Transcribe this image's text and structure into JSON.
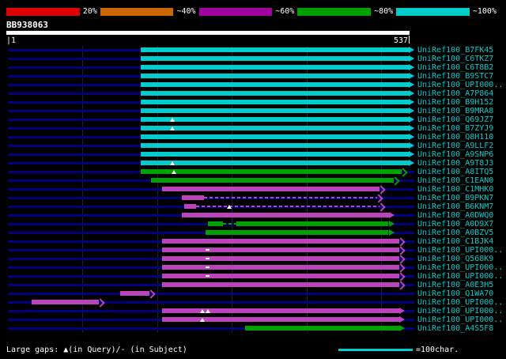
{
  "scale_bar": {
    "segments": [
      {
        "color": "#dd0000",
        "label": "20%"
      },
      {
        "color": "#cc6600",
        "label": "~40%"
      },
      {
        "color": "#a000a0",
        "label": "~60%"
      },
      {
        "color": "#00a000",
        "label": "~80%"
      },
      {
        "color": "#00cccc",
        "label": "~100%"
      }
    ]
  },
  "query": {
    "name": "BB938063",
    "start_label": "|1",
    "end_label": "537",
    "length": 537
  },
  "footer": {
    "gaps_note": "Large gaps: ▲(in Query)/- (in Subject)",
    "scale_label": "=100char."
  },
  "colors": {
    "cyan": "#00cccc",
    "green": "#00a000",
    "magenta": "#bb44bb",
    "query_line": "#000080",
    "grid": "#1a1a42",
    "label_text": "#00cccc"
  },
  "chart_data": {
    "type": "bar",
    "orientation": "horizontal-span",
    "title": "BB938063",
    "xlabel": "query position",
    "x_range": [
      1,
      537
    ],
    "grid_interval": 100,
    "rows": [
      {
        "label": "UniRef100_B7FK45",
        "color": "cyan",
        "segments": [
          [
            178,
            537
          ]
        ],
        "arrow": "filled",
        "markers": []
      },
      {
        "label": "UniRef100_C6TKZ7",
        "color": "cyan",
        "segments": [
          [
            178,
            537
          ]
        ],
        "arrow": "filled",
        "markers": []
      },
      {
        "label": "UniRef100_C6T8B2",
        "color": "cyan",
        "segments": [
          [
            178,
            537
          ]
        ],
        "arrow": "filled",
        "markers": []
      },
      {
        "label": "UniRef100_B9STC7",
        "color": "cyan",
        "segments": [
          [
            178,
            537
          ]
        ],
        "arrow": "filled",
        "markers": []
      },
      {
        "label": "UniRef100_UPI000..",
        "color": "cyan",
        "segments": [
          [
            178,
            537
          ]
        ],
        "arrow": "filled",
        "markers": []
      },
      {
        "label": "UniRef100_A7P864",
        "color": "cyan",
        "segments": [
          [
            178,
            537
          ]
        ],
        "arrow": "filled",
        "markers": []
      },
      {
        "label": "UniRef100_B9H152",
        "color": "cyan",
        "segments": [
          [
            178,
            537
          ]
        ],
        "arrow": "filled",
        "markers": []
      },
      {
        "label": "UniRef100_B9MRA8",
        "color": "cyan",
        "segments": [
          [
            178,
            537
          ]
        ],
        "arrow": "filled",
        "markers": []
      },
      {
        "label": "UniRef100_Q69JZ7",
        "color": "cyan",
        "segments": [
          [
            178,
            537
          ]
        ],
        "arrow": "filled",
        "markers": [
          {
            "pos": 220,
            "type": "tri"
          }
        ]
      },
      {
        "label": "UniRef100_B7ZYJ9",
        "color": "cyan",
        "segments": [
          [
            178,
            537
          ]
        ],
        "arrow": "filled",
        "markers": [
          {
            "pos": 220,
            "type": "tri"
          }
        ]
      },
      {
        "label": "UniRef100_Q8H110",
        "color": "cyan",
        "segments": [
          [
            178,
            537
          ]
        ],
        "arrow": "filled",
        "markers": []
      },
      {
        "label": "UniRef100_A9LLF2",
        "color": "cyan",
        "segments": [
          [
            178,
            537
          ]
        ],
        "arrow": "filled",
        "markers": []
      },
      {
        "label": "UniRef100_A9SNP6",
        "color": "cyan",
        "segments": [
          [
            178,
            537
          ]
        ],
        "arrow": "filled",
        "markers": []
      },
      {
        "label": "UniRef100_A9T8J3",
        "color": "cyan",
        "segments": [
          [
            178,
            537
          ]
        ],
        "arrow": "filled",
        "markers": [
          {
            "pos": 220,
            "type": "tri"
          }
        ]
      },
      {
        "label": "UniRef100_A8ITQ5",
        "color": "green",
        "segments": [
          [
            178,
            527
          ]
        ],
        "arrow": "open",
        "markers": [
          {
            "pos": 222,
            "type": "tri"
          }
        ]
      },
      {
        "label": "UniRef100_C1EAN0",
        "color": "green",
        "segments": [
          [
            192,
            517
          ]
        ],
        "arrow": "open",
        "markers": []
      },
      {
        "label": "UniRef100_C1MHK0",
        "color": "magenta",
        "segments": [
          [
            207,
            498
          ]
        ],
        "arrow": "open",
        "markers": []
      },
      {
        "label": "UniRef100_B9PKN7",
        "color": "magenta",
        "segments": [
          [
            233,
            263
          ],
          [
            263,
            495,
            "thin"
          ]
        ],
        "arrow": "open",
        "markers": []
      },
      {
        "label": "UniRef100_B6KNM7",
        "color": "magenta",
        "segments": [
          [
            236,
            252
          ],
          [
            252,
            498,
            "thin"
          ]
        ],
        "arrow": "open",
        "markers": [
          {
            "pos": 296,
            "type": "tri"
          }
        ]
      },
      {
        "label": "UniRef100_A0DWQ0",
        "color": "magenta",
        "segments": [
          [
            233,
            510
          ]
        ],
        "arrow": "filled",
        "markers": []
      },
      {
        "label": "UniRef100_A0D9X7",
        "color": "green",
        "segments": [
          [
            268,
            288
          ],
          [
            288,
            306,
            "thin"
          ],
          [
            306,
            510
          ]
        ],
        "arrow": "filled",
        "markers": []
      },
      {
        "label": "UniRef100_A0BZV5",
        "color": "green",
        "segments": [
          [
            265,
            510
          ]
        ],
        "arrow": "filled",
        "markers": []
      },
      {
        "label": "UniRef100_C1BJK4",
        "color": "magenta",
        "segments": [
          [
            207,
            524
          ]
        ],
        "arrow": "open",
        "markers": []
      },
      {
        "label": "UniRef100_UPI000..",
        "color": "magenta",
        "segments": [
          [
            207,
            524
          ]
        ],
        "arrow": "open",
        "markers": [
          {
            "pos": 268,
            "type": "dash"
          }
        ]
      },
      {
        "label": "UniRef100_Q568K9",
        "color": "magenta",
        "segments": [
          [
            207,
            524
          ]
        ],
        "arrow": "open",
        "markers": [
          {
            "pos": 268,
            "type": "dash"
          }
        ]
      },
      {
        "label": "UniRef100_UPI000..",
        "color": "magenta",
        "segments": [
          [
            207,
            524
          ]
        ],
        "arrow": "open",
        "markers": [
          {
            "pos": 268,
            "type": "dash"
          }
        ]
      },
      {
        "label": "UniRef100_UPI000..",
        "color": "magenta",
        "segments": [
          [
            207,
            524
          ]
        ],
        "arrow": "open",
        "markers": [
          {
            "pos": 268,
            "type": "dash"
          }
        ]
      },
      {
        "label": "UniRef100_A0E3H5",
        "color": "magenta",
        "segments": [
          [
            207,
            524
          ]
        ],
        "arrow": "open",
        "markers": []
      },
      {
        "label": "UniRef100_Q1WA70",
        "color": "magenta",
        "segments": [
          [
            150,
            190
          ]
        ],
        "arrow": "open",
        "markers": []
      },
      {
        "label": "UniRef100_UPI000..",
        "color": "magenta",
        "segments": [
          [
            32,
            122
          ]
        ],
        "arrow": "open",
        "markers": []
      },
      {
        "label": "UniRef100_UPI000..",
        "color": "magenta",
        "segments": [
          [
            207,
            524
          ]
        ],
        "arrow": "filled",
        "markers": [
          {
            "pos": 260,
            "type": "tri"
          },
          {
            "pos": 268,
            "type": "tri"
          }
        ]
      },
      {
        "label": "UniRef100_UPI000..",
        "color": "magenta",
        "segments": [
          [
            207,
            524
          ]
        ],
        "arrow": "filled",
        "markers": [
          {
            "pos": 260,
            "type": "tri"
          }
        ]
      },
      {
        "label": "UniRef100_A4S5F8",
        "color": "green",
        "segments": [
          [
            318,
            524
          ]
        ],
        "arrow": "filled",
        "markers": []
      }
    ]
  }
}
